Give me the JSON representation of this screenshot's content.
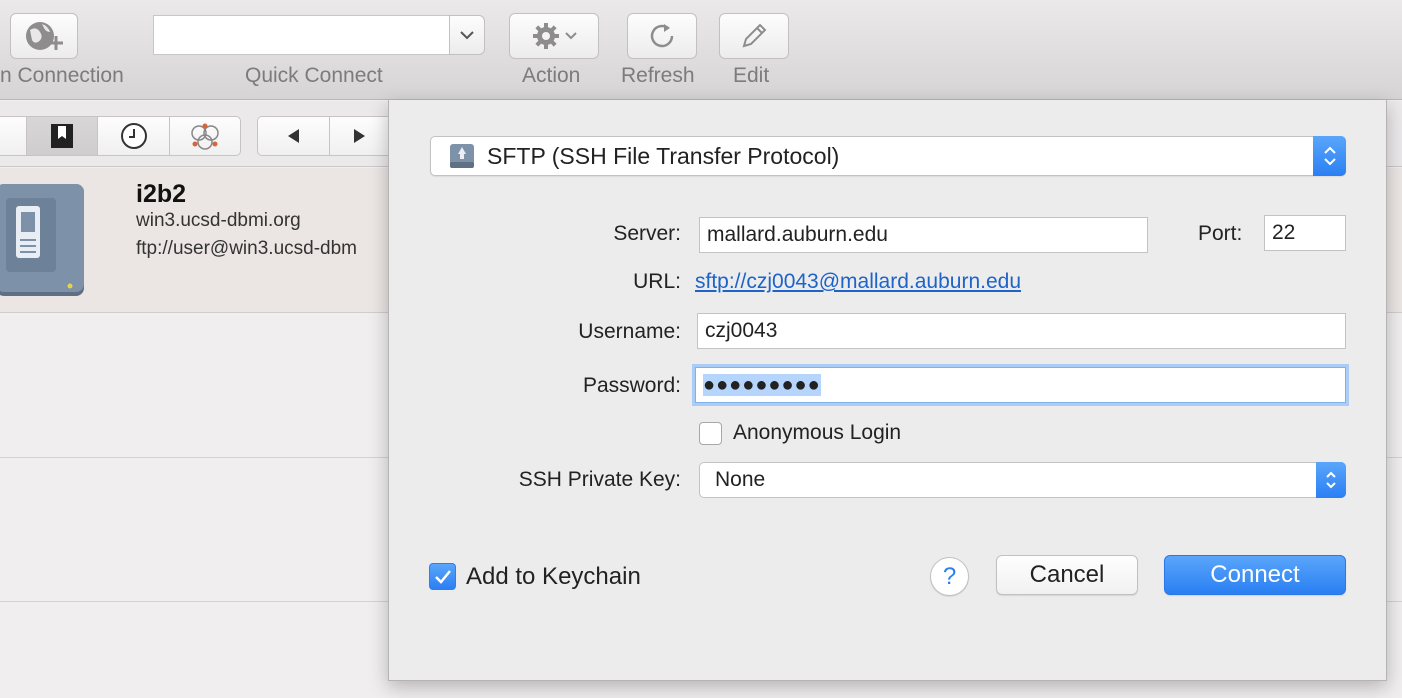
{
  "toolbar": {
    "open_connection_label": "n Connection",
    "quick_connect_label": "Quick Connect",
    "quick_connect_value": "",
    "action_label": "Action",
    "refresh_label": "Refresh",
    "edit_label": "Edit"
  },
  "bookmark": {
    "title": "i2b2",
    "hostname": "win3.ucsd-dbmi.org",
    "url": "ftp://user@win3.ucsd-dbm"
  },
  "dialog": {
    "protocol": "SFTP (SSH File Transfer Protocol)",
    "server_label": "Server:",
    "server_value": "mallard.auburn.edu",
    "port_label": "Port:",
    "port_value": "22",
    "url_label": "URL:",
    "url_value": "sftp://czj0043@mallard.auburn.edu",
    "username_label": "Username:",
    "username_value": "czj0043",
    "password_label": "Password:",
    "password_value": "●●●●●●●●●",
    "anonymous_label": "Anonymous Login",
    "anonymous_checked": false,
    "ssh_key_label": "SSH Private Key:",
    "ssh_key_value": "None",
    "keychain_label": "Add to Keychain",
    "keychain_checked": true,
    "help_label": "?",
    "cancel_label": "Cancel",
    "connect_label": "Connect"
  },
  "colors": {
    "accent": "#2a7ff3",
    "link": "#1d63c9",
    "selection": "#b5d5fd"
  }
}
